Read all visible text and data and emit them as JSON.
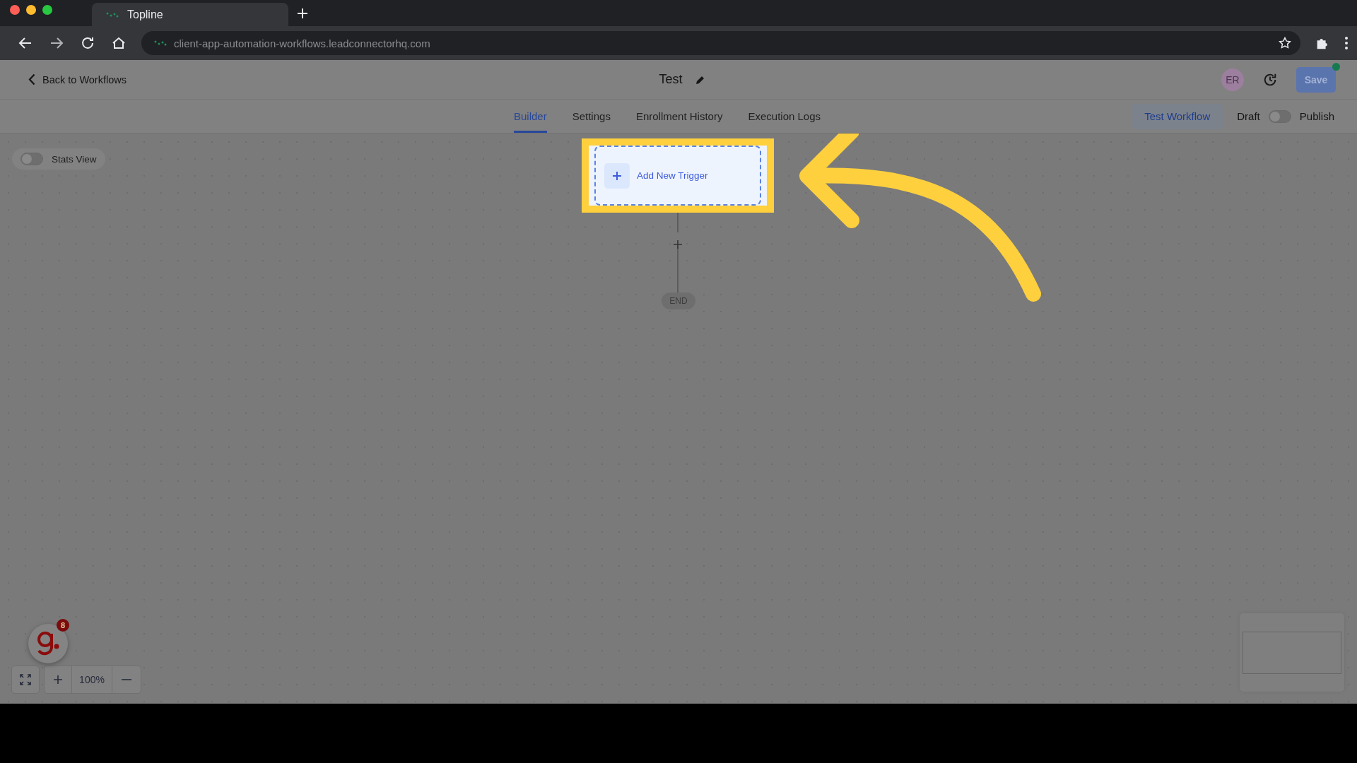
{
  "browser": {
    "tab_title": "Topline",
    "url": "client-app-automation-workflows.leadconnectorhq.com"
  },
  "header": {
    "back_link": "Back to Workflows",
    "title": "Test",
    "avatar": "ER",
    "save_button": "Save"
  },
  "tabs": [
    {
      "label": "Builder",
      "selected": true
    },
    {
      "label": "Settings",
      "selected": false
    },
    {
      "label": "Enrollment History",
      "selected": false
    },
    {
      "label": "Execution Logs",
      "selected": false
    }
  ],
  "test_button": "Test Workflow",
  "status_toggle": {
    "off_label": "Draft",
    "on_label": "Publish",
    "on": false
  },
  "stats_toggle": {
    "label": "Stats View",
    "on": false
  },
  "trigger": {
    "label": "Add New Trigger",
    "highlighted": true
  },
  "end_node": "END",
  "zoom": {
    "level_text": "100%"
  },
  "help_widget": {
    "badge": "8"
  }
}
